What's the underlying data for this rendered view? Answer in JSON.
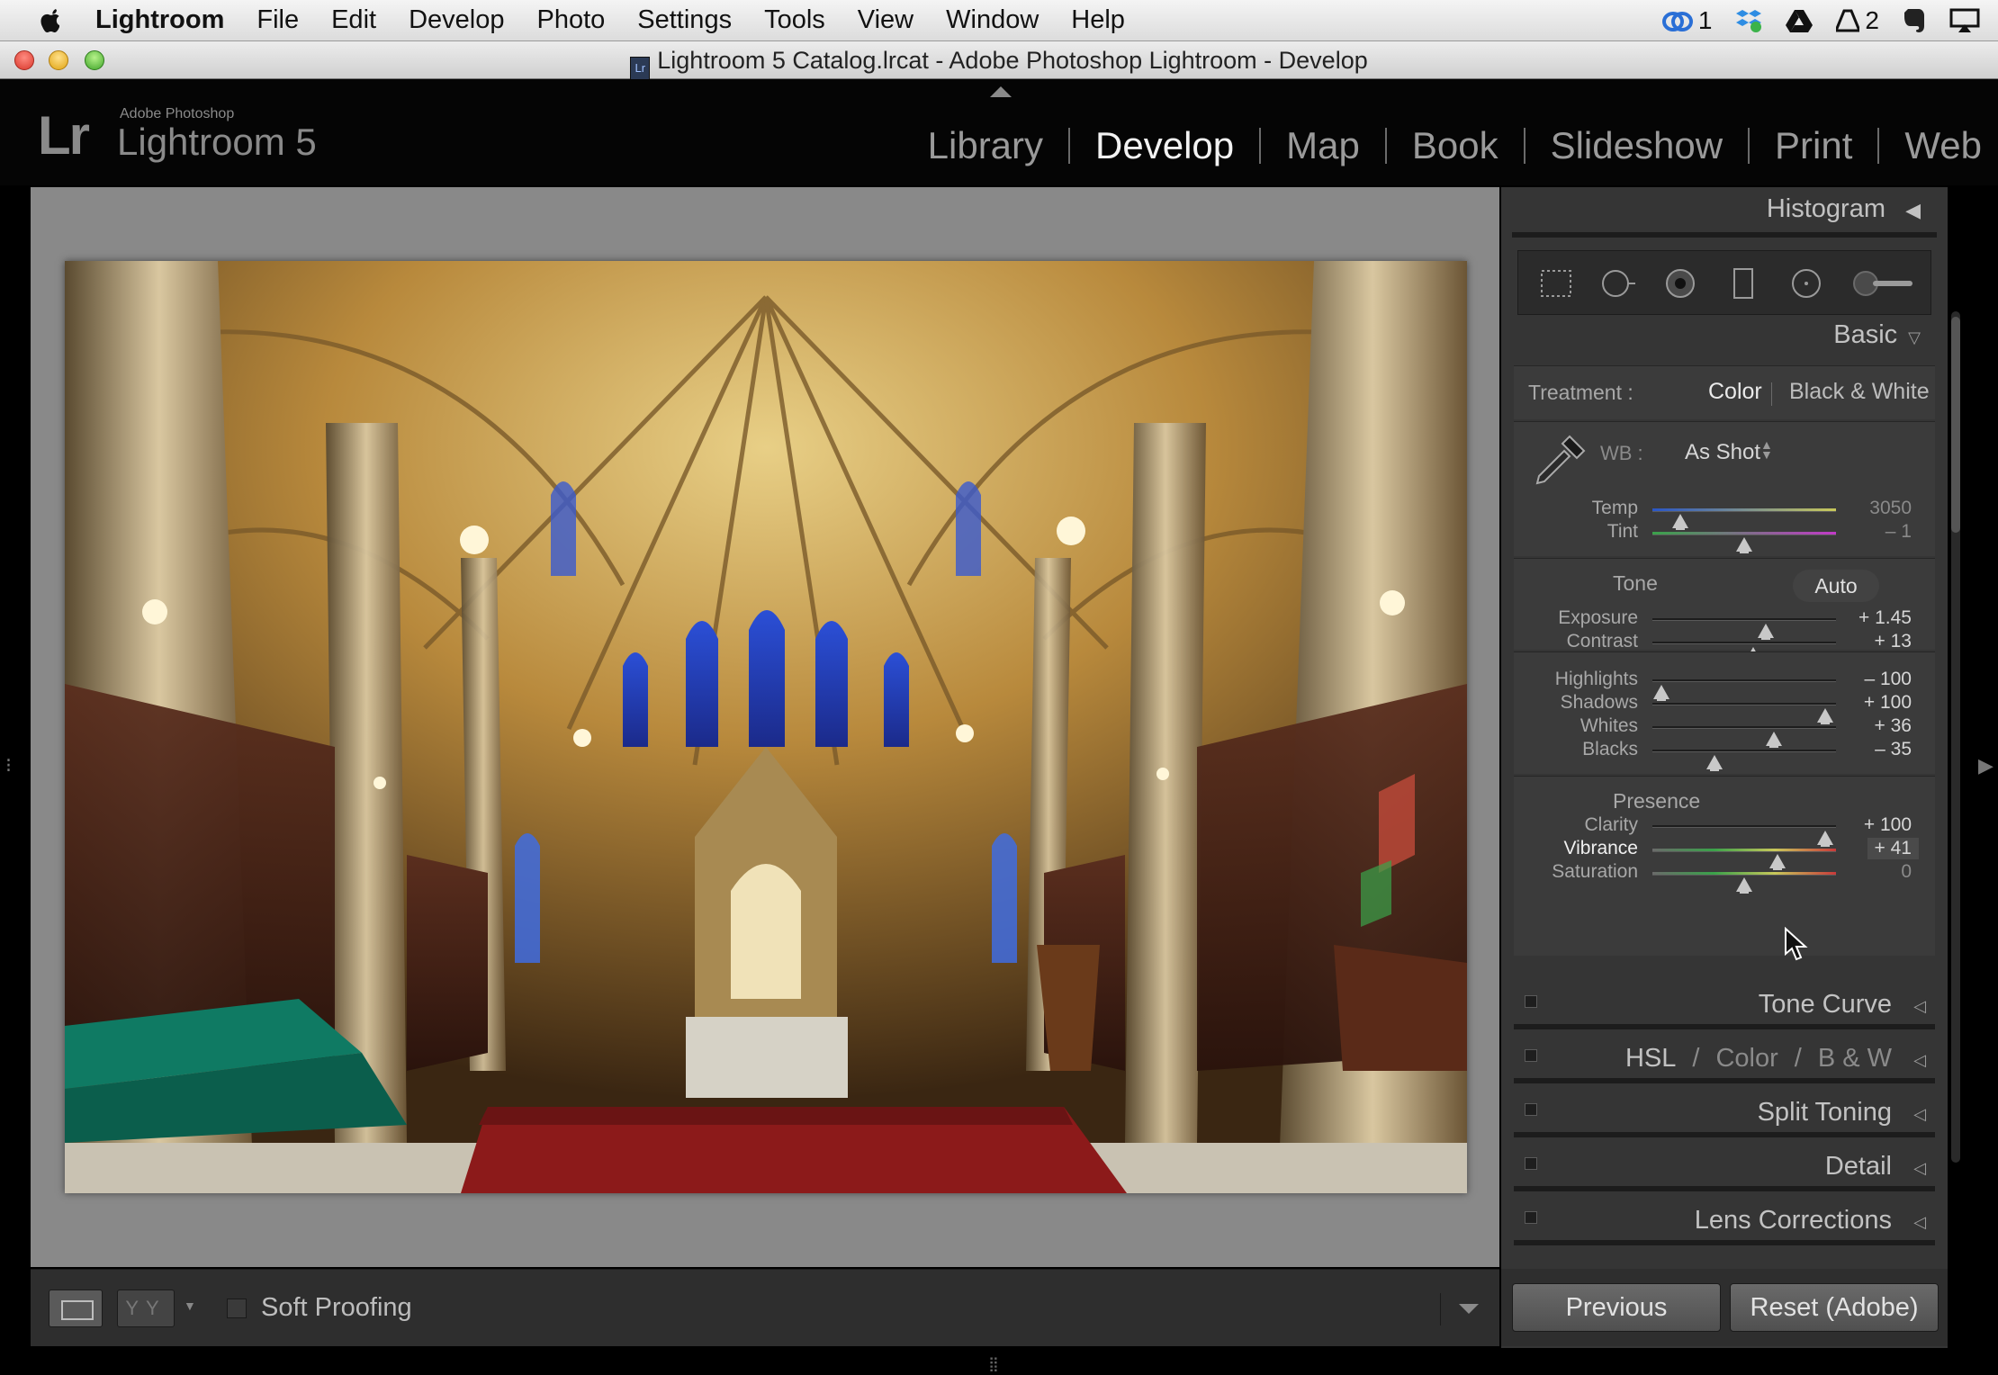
{
  "menubar": {
    "app_name": "Lightroom",
    "items": [
      "File",
      "Edit",
      "Develop",
      "Photo",
      "Settings",
      "Tools",
      "View",
      "Window",
      "Help"
    ],
    "status": {
      "cc_count": "1",
      "adobe_count": "2"
    }
  },
  "window": {
    "title": "Lightroom 5 Catalog.lrcat - Adobe Photoshop Lightroom - Develop"
  },
  "identity": {
    "logo_mark": "Lr",
    "brand_line": "Adobe Photoshop",
    "product_name": "Lightroom 5"
  },
  "modules": [
    {
      "label": "Library",
      "active": false
    },
    {
      "label": "Develop",
      "active": true
    },
    {
      "label": "Map",
      "active": false
    },
    {
      "label": "Book",
      "active": false
    },
    {
      "label": "Slideshow",
      "active": false
    },
    {
      "label": "Print",
      "active": false
    },
    {
      "label": "Web",
      "active": false
    }
  ],
  "toolbar": {
    "yy_label": "YY",
    "soft_proofing_label": "Soft Proofing",
    "soft_proofing_checked": false
  },
  "panels": {
    "histogram_title": "Histogram",
    "basic_title": "Basic",
    "treatment_label": "Treatment :",
    "treatment_color": "Color",
    "treatment_bw": "Black & White",
    "treatment_selected": "Color",
    "wb_label": "WB :",
    "wb_value": "As Shot",
    "tone_title": "Tone",
    "auto_label": "Auto",
    "presence_title": "Presence"
  },
  "sliders": {
    "temp": {
      "label": "Temp",
      "value": "3050",
      "position": 0.15
    },
    "tint": {
      "label": "Tint",
      "value": "– 1",
      "position": 0.5
    },
    "exposure": {
      "label": "Exposure",
      "value": "+ 1.45",
      "position": 0.62
    },
    "contrast": {
      "label": "Contrast",
      "value": "+ 13",
      "position": 0.55
    },
    "highlights": {
      "label": "Highlights",
      "value": "– 100",
      "position": 0.05
    },
    "shadows": {
      "label": "Shadows",
      "value": "+ 100",
      "position": 0.94
    },
    "whites": {
      "label": "Whites",
      "value": "+ 36",
      "position": 0.66
    },
    "blacks": {
      "label": "Blacks",
      "value": "– 35",
      "position": 0.34
    },
    "clarity": {
      "label": "Clarity",
      "value": "+ 100",
      "position": 0.94
    },
    "vibrance": {
      "label": "Vibrance",
      "value": "+ 41",
      "position": 0.68
    },
    "saturation": {
      "label": "Saturation",
      "value": "0",
      "position": 0.5
    }
  },
  "collapsed_panels": {
    "tone_curve": "Tone Curve",
    "hsl": "HSL",
    "hsl_color": "Color",
    "hsl_bw": "B & W",
    "hsl_sep": "/",
    "split_toning": "Split Toning",
    "detail": "Detail",
    "lens_corrections": "Lens Corrections"
  },
  "buttons": {
    "previous": "Previous",
    "reset": "Reset (Adobe)"
  },
  "colors": {
    "panel_bg": "#353535",
    "section_bg": "#3b3b3b",
    "active_module": "#f2f2f2",
    "canvas_bg": "#898989"
  }
}
